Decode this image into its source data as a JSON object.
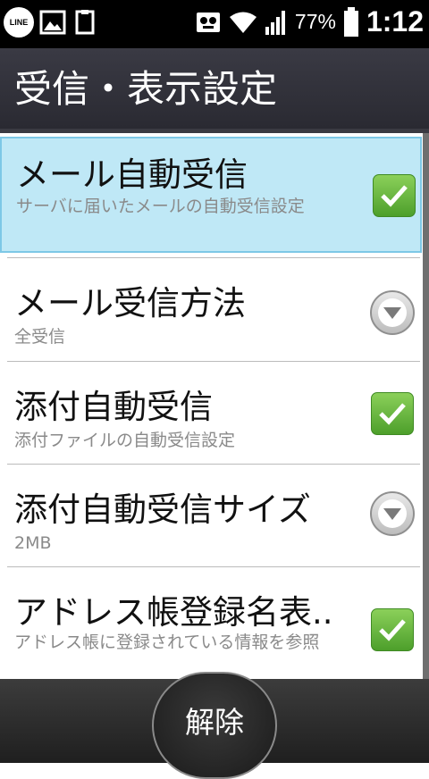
{
  "status_bar": {
    "icons_left": [
      "line-icon",
      "gallery-icon",
      "clipboard-icon"
    ],
    "line_label": "LINE",
    "battery_percent": "77%",
    "time": "1:12"
  },
  "header": {
    "title": "受信・表示設定"
  },
  "settings": {
    "items": [
      {
        "title": "メール自動受信",
        "subtitle": "サーバに届いたメールの自動受信設定",
        "control": "checkbox",
        "checked": true
      },
      {
        "title": "メール受信方法",
        "subtitle": "全受信",
        "control": "dropdown"
      },
      {
        "title": "添付自動受信",
        "subtitle": "添付ファイルの自動受信設定",
        "control": "checkbox",
        "checked": true
      },
      {
        "title": "添付自動受信サイズ",
        "subtitle": "2MB",
        "control": "dropdown"
      },
      {
        "title": "アドレス帳登録名表..",
        "subtitle": "アドレス帳に登録されている情報を参照",
        "control": "checkbox",
        "checked": true
      }
    ]
  },
  "footer": {
    "button_label": "解除"
  },
  "colors": {
    "selected_bg": "#bfe8f6",
    "checkbox_green": "#5aae34"
  }
}
